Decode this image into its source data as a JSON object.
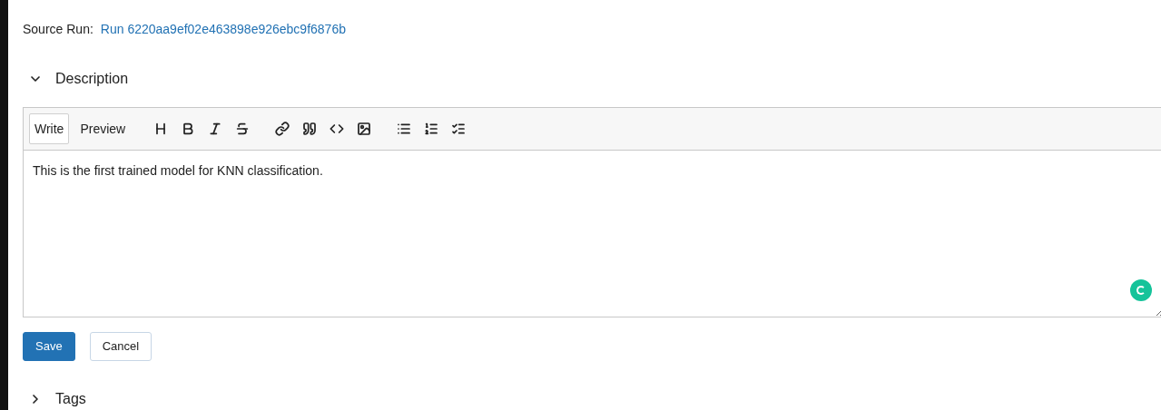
{
  "source_run": {
    "label": "Source Run:",
    "link": "Run 6220aa9ef02e463898e926ebc9f6876b"
  },
  "description": {
    "title": "Description",
    "expanded": true,
    "editor": {
      "tabs": [
        {
          "label": "Write",
          "selected": true
        },
        {
          "label": "Preview",
          "selected": false
        }
      ],
      "tool_groups": [
        [
          {
            "kind": "heading"
          },
          {
            "kind": "bold"
          },
          {
            "kind": "italic"
          },
          {
            "kind": "strike"
          }
        ],
        [
          {
            "kind": "link"
          },
          {
            "kind": "quote"
          },
          {
            "kind": "code"
          },
          {
            "kind": "image"
          }
        ],
        [
          {
            "kind": "bullets"
          },
          {
            "kind": "numbers"
          },
          {
            "kind": "tasks"
          }
        ]
      ],
      "value": "This is the first trained model for KNN classification."
    },
    "buttons": [
      {
        "label": "Save",
        "kind": "primary"
      },
      {
        "label": "Cancel",
        "kind": "secondary"
      }
    ]
  },
  "tags": {
    "title": "Tags",
    "expanded": false
  }
}
